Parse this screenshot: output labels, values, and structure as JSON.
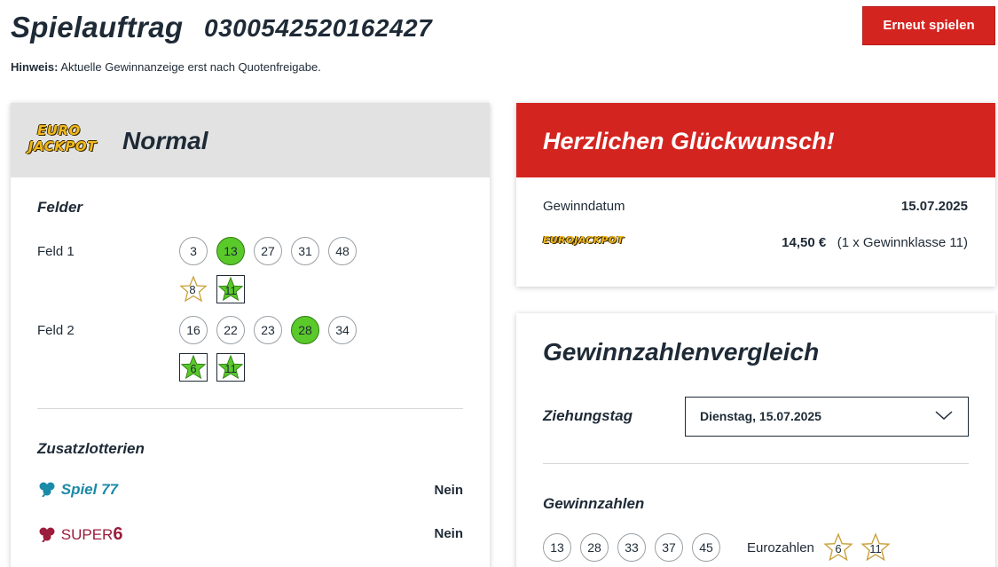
{
  "header": {
    "title": "Spielauftrag",
    "order_number": "0300542520162427",
    "replay_button": "Erneut spielen",
    "hint_label": "Hinweis:",
    "hint_text": "Aktuelle Gewinnanzeige erst nach Quotenfreigabe."
  },
  "ticket": {
    "logo_line1": "EURO",
    "logo_line2": "JACKPOT",
    "variant": "Normal",
    "fields_title": "Felder",
    "fields": [
      {
        "label": "Feld 1",
        "numbers": [
          {
            "value": "3",
            "hit": false
          },
          {
            "value": "13",
            "hit": true
          },
          {
            "value": "27",
            "hit": false
          },
          {
            "value": "31",
            "hit": false
          },
          {
            "value": "48",
            "hit": false
          }
        ],
        "euro": [
          {
            "value": "8",
            "hit": false
          },
          {
            "value": "11",
            "hit": true
          }
        ]
      },
      {
        "label": "Feld 2",
        "numbers": [
          {
            "value": "16",
            "hit": false
          },
          {
            "value": "22",
            "hit": false
          },
          {
            "value": "23",
            "hit": false
          },
          {
            "value": "28",
            "hit": true
          },
          {
            "value": "34",
            "hit": false
          }
        ],
        "euro": [
          {
            "value": "6",
            "hit": true
          },
          {
            "value": "11",
            "hit": true
          }
        ]
      }
    ],
    "addons_title": "Zusatzlotterien",
    "addons": [
      {
        "name": "Spiel 77",
        "value": "Nein",
        "color": "#1a8aa8",
        "icon": "clover-icon"
      },
      {
        "name": "SUPER",
        "digit": "6",
        "value": "Nein",
        "color": "#9c1c3c",
        "icon": "clover-icon"
      }
    ]
  },
  "win": {
    "title": "Herzlichen Glückwunsch!",
    "date_label": "Gewinndatum",
    "date_value": "15.07.2025",
    "logo_text": "EUROJACKPOT",
    "amount": "14,50 €",
    "amount_detail": "(1 x Gewinnklasse 11)"
  },
  "comparison": {
    "title": "Gewinnzahlenvergleich",
    "draw_day_label": "Ziehungstag",
    "draw_day_value": "Dienstag, 15.07.2025",
    "winning_title": "Gewinnzahlen",
    "winning_numbers": [
      "13",
      "28",
      "33",
      "37",
      "45"
    ],
    "euro_label": "Eurozahlen",
    "euro_numbers": [
      "6",
      "11"
    ]
  },
  "colors": {
    "accent_red": "#d42420",
    "hit_green": "#5ac92a",
    "star_gold": "#c9a03a"
  }
}
